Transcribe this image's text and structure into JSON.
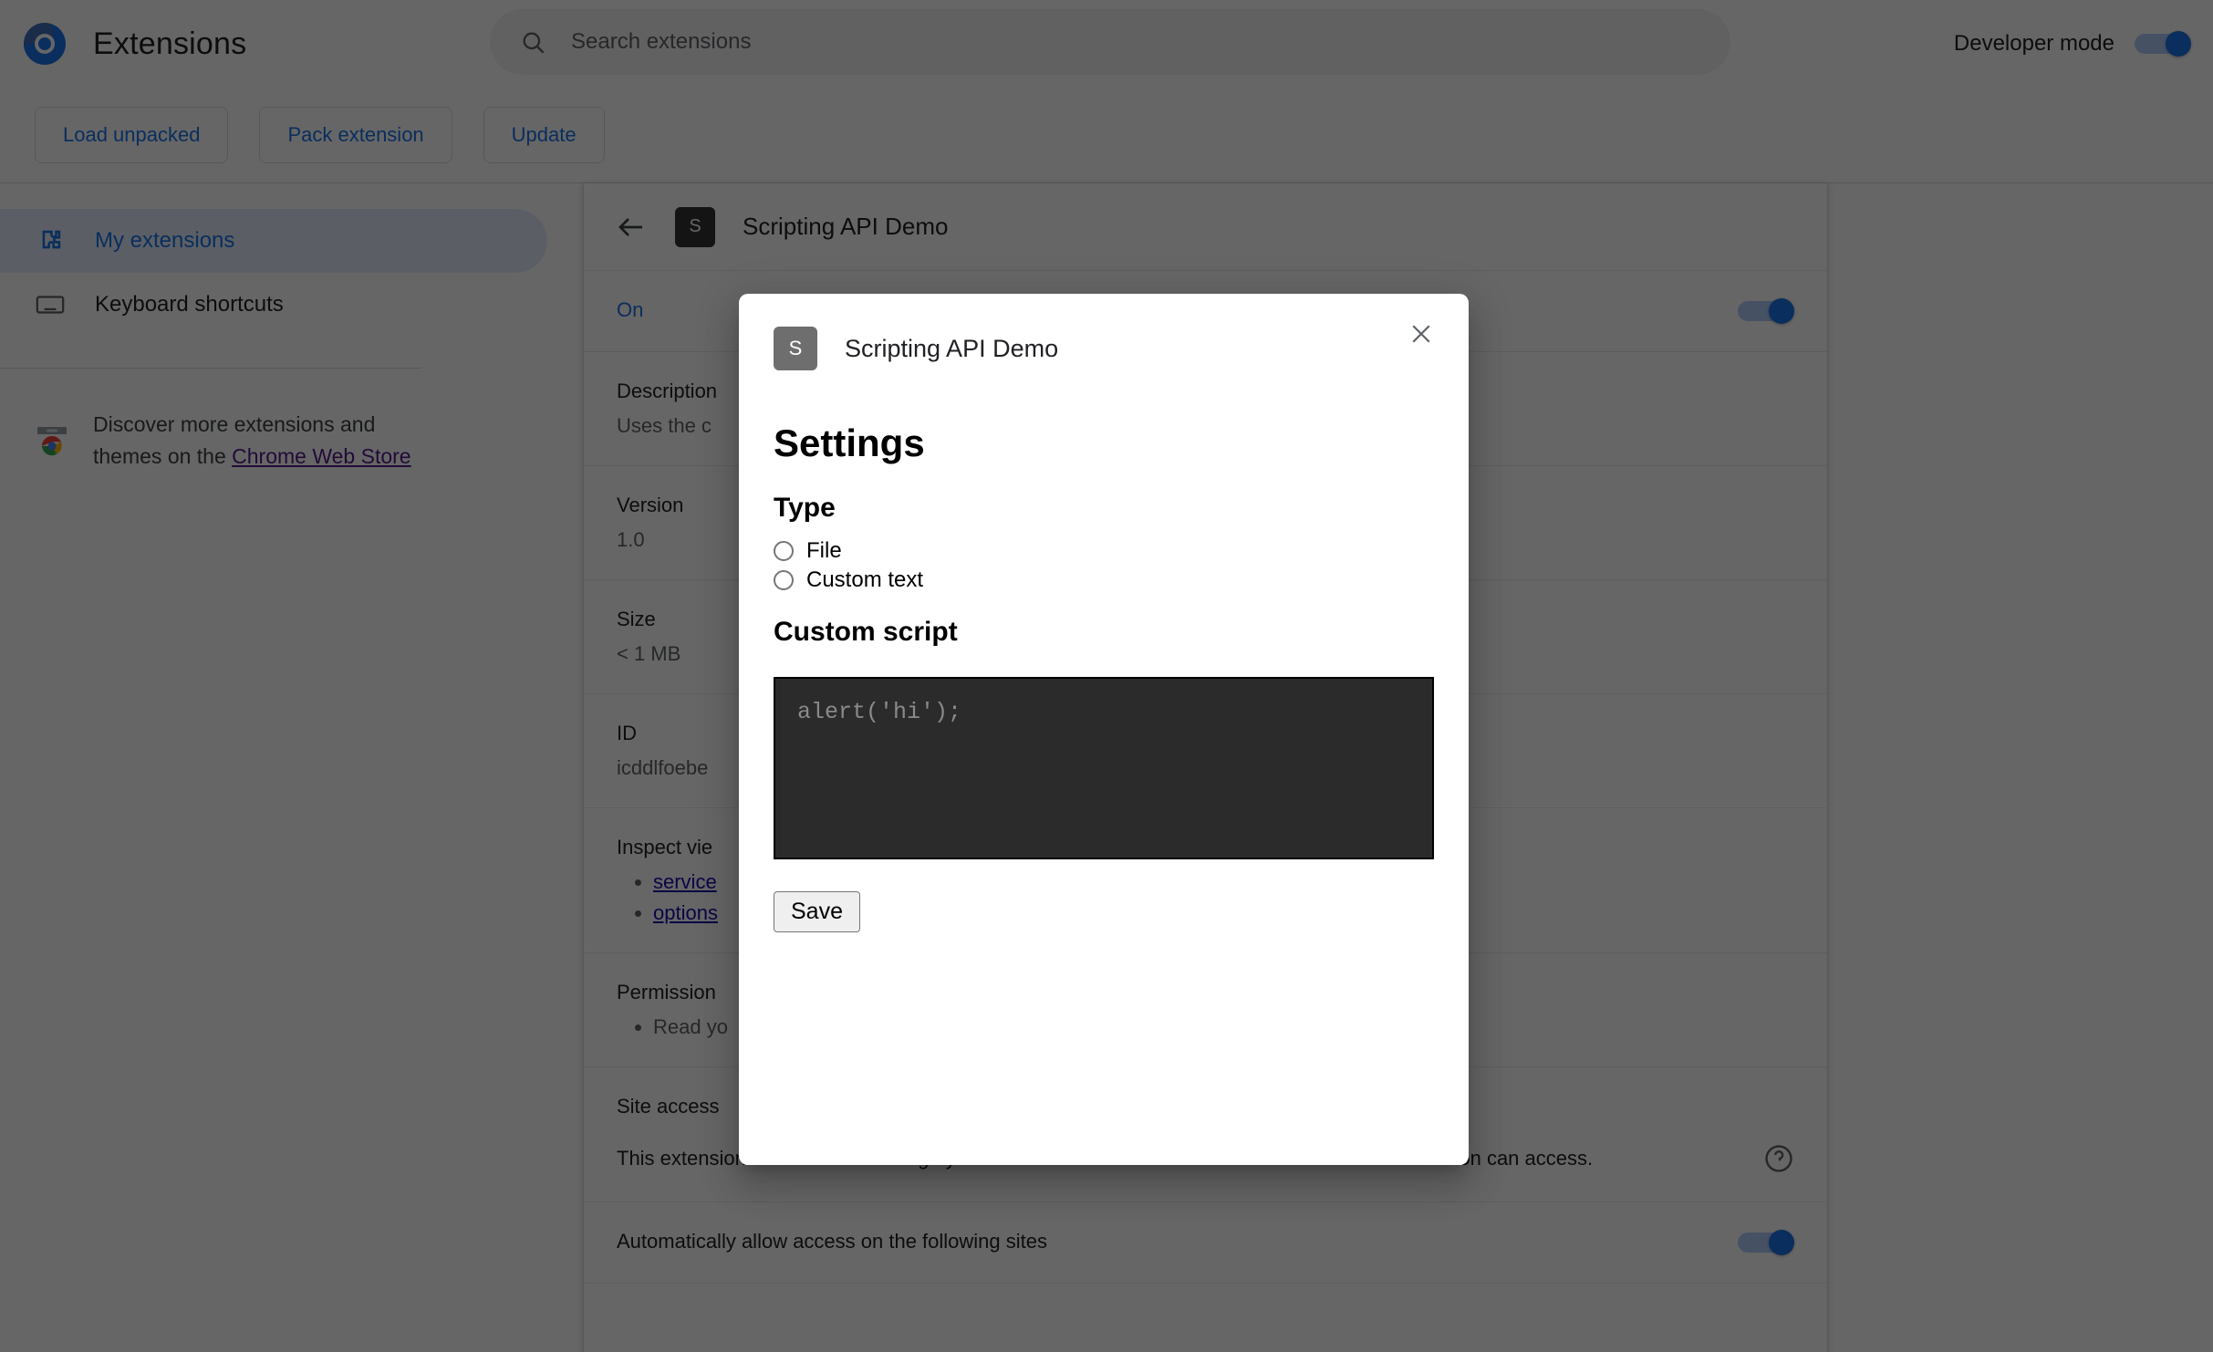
{
  "toolbar": {
    "logo_icon": "chrome-logo-icon",
    "title": "Extensions",
    "search": {
      "icon": "search-icon",
      "placeholder": "Search extensions",
      "value": ""
    },
    "developer_mode": {
      "label": "Developer mode",
      "enabled": true
    },
    "buttons": [
      {
        "label": "Load unpacked"
      },
      {
        "label": "Pack extension"
      },
      {
        "label": "Update"
      }
    ]
  },
  "sidebar": {
    "items": [
      {
        "label": "My extensions",
        "icon": "puzzle-icon",
        "active": true
      },
      {
        "label": "Keyboard shortcuts",
        "icon": "keyboard-icon",
        "active": false
      }
    ],
    "discover": {
      "icon": "chrome-web-store-icon",
      "text_before": "Discover more extensions and themes on the ",
      "link": "Chrome Web Store"
    }
  },
  "detail": {
    "back_icon": "back-arrow-icon",
    "chip_letter": "S",
    "title": "Scripting API Demo",
    "enabled_label": "On",
    "enabled": true,
    "rows": [
      {
        "key": "Description",
        "value": "Uses the c"
      },
      {
        "key": "Version",
        "value": "1.0"
      },
      {
        "key": "Size",
        "value": "< 1 MB"
      },
      {
        "key": "ID",
        "value": "icddlfoebe"
      }
    ],
    "inspect_views": {
      "key": "Inspect vie",
      "links": [
        "service",
        "options"
      ]
    },
    "permissions": {
      "key": "Permission",
      "items": [
        "Read yo"
      ]
    },
    "site_access": {
      "key": "Site access",
      "body": "This extension can read and change your data on sites. You can control which sites the extension can access.",
      "help_icon": "help-circle-icon",
      "auto_allow_label": "Automatically allow access on the following sites",
      "auto_allow_enabled": true
    }
  },
  "modal": {
    "chip_letter": "S",
    "title": "Scripting API Demo",
    "close_icon": "close-icon",
    "heading": "Settings",
    "type_heading": "Type",
    "type_options": [
      {
        "label": "File",
        "checked": false
      },
      {
        "label": "Custom text",
        "checked": false
      }
    ],
    "custom_script_heading": "Custom script",
    "custom_script": {
      "placeholder": "alert('hi');",
      "value": ""
    },
    "save_label": "Save"
  },
  "colors": {
    "accent": "#1a73e8",
    "link": "#1a0dab",
    "visited_link": "#551a8b",
    "scrim": "rgba(0,0,0,0.6)",
    "code_bg": "#2b2b2b"
  }
}
